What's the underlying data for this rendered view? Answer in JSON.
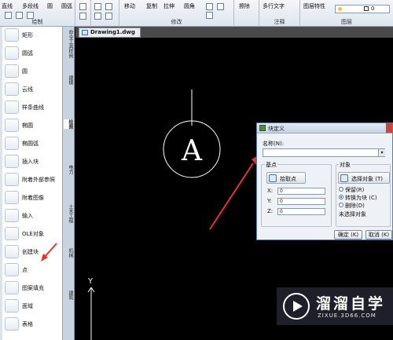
{
  "ribbon": {
    "commands": {
      "line": "直线",
      "polyline": "多段线",
      "circle": "圆",
      "arc": "圆弧",
      "move": "移动",
      "copy": "复制",
      "stretch": "拉伸",
      "fillet": "圆角",
      "erase": "擦除",
      "mtext": "多行文字",
      "layer_props": "图层特性"
    },
    "groups": {
      "draw": "绘制",
      "modify": "修改",
      "annotate": "注释",
      "layers": "图层"
    },
    "layer_value": "0"
  },
  "palette": {
    "items": [
      {
        "label": "矩形",
        "icon": "rectangle-icon"
      },
      {
        "label": "圆弧",
        "icon": "arc-icon"
      },
      {
        "label": "圆",
        "icon": "circle-icon"
      },
      {
        "label": "云线",
        "icon": "revcloud-icon"
      },
      {
        "label": "样条曲线",
        "icon": "spline-icon"
      },
      {
        "label": "椭圆",
        "icon": "ellipse-icon"
      },
      {
        "label": "椭圆弧",
        "icon": "elliptical-arc-icon"
      },
      {
        "label": "插入块",
        "icon": "insert-block-icon"
      },
      {
        "label": "附着外部参照",
        "icon": "xref-icon"
      },
      {
        "label": "附着图像",
        "icon": "image-icon"
      },
      {
        "label": "输入",
        "icon": "import-icon"
      },
      {
        "label": "OLE对象",
        "icon": "ole-icon"
      },
      {
        "label": "创建块",
        "icon": "create-block-icon"
      },
      {
        "label": "点",
        "icon": "point-icon"
      },
      {
        "label": "图案填充",
        "icon": "hatch-icon"
      },
      {
        "label": "面域",
        "icon": "region-icon"
      },
      {
        "label": "表格",
        "icon": "table-icon"
      }
    ],
    "side_tabs": [
      "命令工具样例",
      "建模",
      "绘图",
      "电力",
      "土木工程",
      "机械",
      "建筑"
    ]
  },
  "document": {
    "tab_label": "Drawing1.dwg"
  },
  "drawing": {
    "circle_letter": "A",
    "ucs_y": "Y"
  },
  "dialog": {
    "title": "块定义",
    "name_label": "名称(N):",
    "name_value": "",
    "base_point": {
      "heading": "基点",
      "pick_button": "拾取点",
      "x_label": "X:",
      "y_label": "Y:",
      "z_label": "Z:",
      "x": "0",
      "y": "0",
      "z": "0"
    },
    "objects": {
      "heading": "对象",
      "select_button": "选择对象 (T)",
      "retain": "保留(R)",
      "convert": "转换为块 (C)",
      "delete": "删除(D)",
      "selected_count": "未选择对象",
      "selected_option": "convert"
    },
    "ok": "确定 (K)",
    "cancel": "取消 (K)"
  },
  "watermark": {
    "name": "溜溜自学",
    "url": "ZIXUE.3D66.COM"
  },
  "colors": {
    "annotation_arrow": "#e8342c",
    "canvas": "#000000",
    "drawing_line": "#ffffff"
  }
}
